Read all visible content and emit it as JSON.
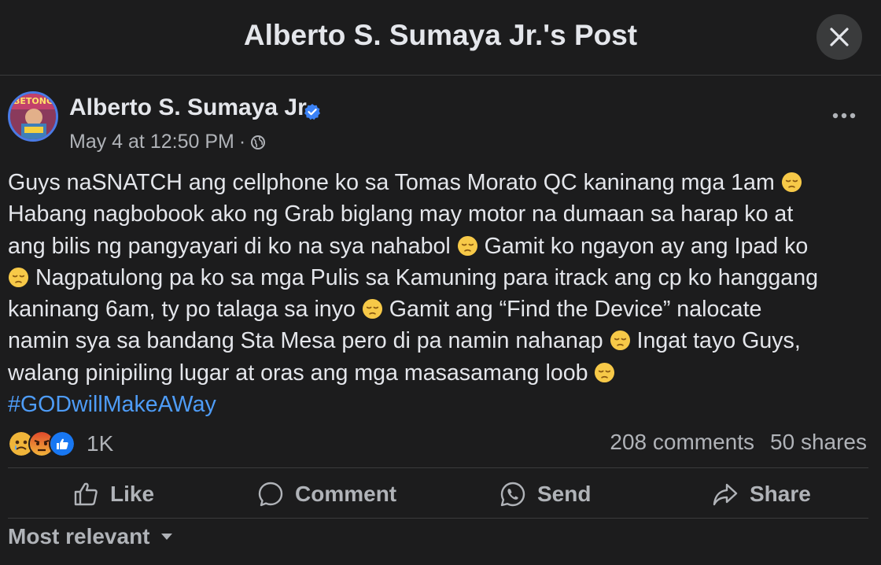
{
  "header": {
    "title": "Alberto S. Sumaya Jr.'s Post",
    "close_icon": "close-icon"
  },
  "post": {
    "author": "Alberto S. Sumaya Jr.",
    "avatar_text": "BETONG",
    "timestamp": "May 4 at 12:50 PM",
    "separator": "·",
    "privacy_icon": "globe-icon",
    "more_icon": "more-horizontal-icon",
    "verified_icon": "verified-badge-icon",
    "text_lines": [
      [
        "Guys naSNATCH ang cellphone ko sa Tomas Morato QC kaninang mga 1am ",
        ":emoji:"
      ],
      [
        "Habang nagbobook ako ng Grab biglang may motor na dumaan sa harap ko at"
      ],
      [
        "ang bilis ng pangyayari di ko na sya nahabol ",
        ":emoji:",
        " Gamit ko ngayon ay ang Ipad ko"
      ],
      [
        ":emoji:",
        " Nagpatulong pa ko sa mga Pulis sa Kamuning para itrack ang cp ko hanggang"
      ],
      [
        "kaninang 6am, ty po talaga sa inyo ",
        ":emoji:",
        " Gamit ang “Find the Device” nalocate"
      ],
      [
        "namin sya sa bandang Sta Mesa pero di pa namin nahanap ",
        ":emoji:",
        " Ingat tayo Guys,"
      ],
      [
        "walang pinipiling lugar at oras ang mga masasamang loob ",
        ":emoji:"
      ]
    ],
    "hashtag": "#GODwillMakeAWay",
    "emoji_name": "disappointed-face-emoji"
  },
  "engagement": {
    "reactions": [
      "sad-reaction-icon",
      "angry-reaction-icon",
      "like-reaction-icon"
    ],
    "reaction_count": "1K",
    "comments": "208 comments",
    "shares": "50 shares"
  },
  "actions": {
    "like": "Like",
    "comment": "Comment",
    "send": "Send",
    "share": "Share"
  },
  "comments_sort": {
    "label": "Most relevant"
  },
  "colors": {
    "background": "#1c1c1d",
    "text": "#e4e6eb",
    "secondary": "#b0b3b8",
    "hashtag": "#4e9cf7",
    "verified": "#3b82f6",
    "like_blue": "#1877f2"
  }
}
